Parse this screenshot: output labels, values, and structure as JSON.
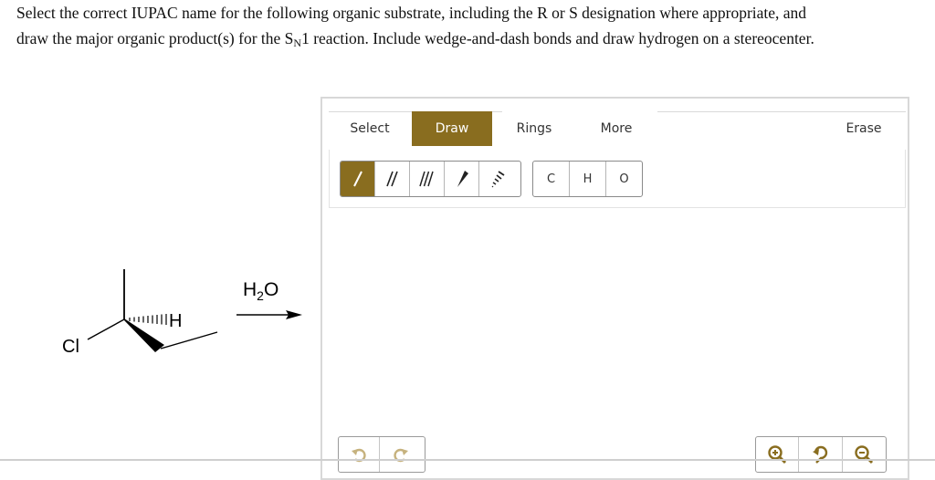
{
  "question": {
    "line1": "Select the correct IUPAC name for the following organic substrate, including the R or S designation where appropriate, and",
    "line2_prefix": "draw the major organic product(s) for the S",
    "line2_subscript": "N",
    "line2_suffix": "1 reaction. Include wedge-and-dash bonds and draw hydrogen on a stereocenter."
  },
  "molecule": {
    "atom_cl": "Cl",
    "atom_h": "H",
    "reagent_main": "H",
    "reagent_sub": "2",
    "reagent_end": "O"
  },
  "editor": {
    "tabs": [
      {
        "label": "Select",
        "active": false
      },
      {
        "label": "Draw",
        "active": true
      },
      {
        "label": "Rings",
        "active": false
      },
      {
        "label": "More",
        "active": false
      },
      {
        "label": "Erase",
        "active": false
      }
    ],
    "bond_tools": [
      {
        "icon": "single-bond-icon",
        "selected": true
      },
      {
        "icon": "double-bond-icon",
        "selected": false
      },
      {
        "icon": "triple-bond-icon",
        "selected": false
      },
      {
        "icon": "wedge-bond-icon",
        "selected": false
      },
      {
        "icon": "dash-bond-icon",
        "selected": false
      }
    ],
    "atoms": [
      "C",
      "H",
      "O"
    ],
    "history_icons": [
      "undo-icon",
      "redo-icon"
    ],
    "zoom_icons": [
      "zoom-in-icon",
      "reset-view-icon",
      "zoom-out-icon"
    ],
    "colors": {
      "accent": "#896d1f",
      "border": "#d8d8d8"
    }
  }
}
